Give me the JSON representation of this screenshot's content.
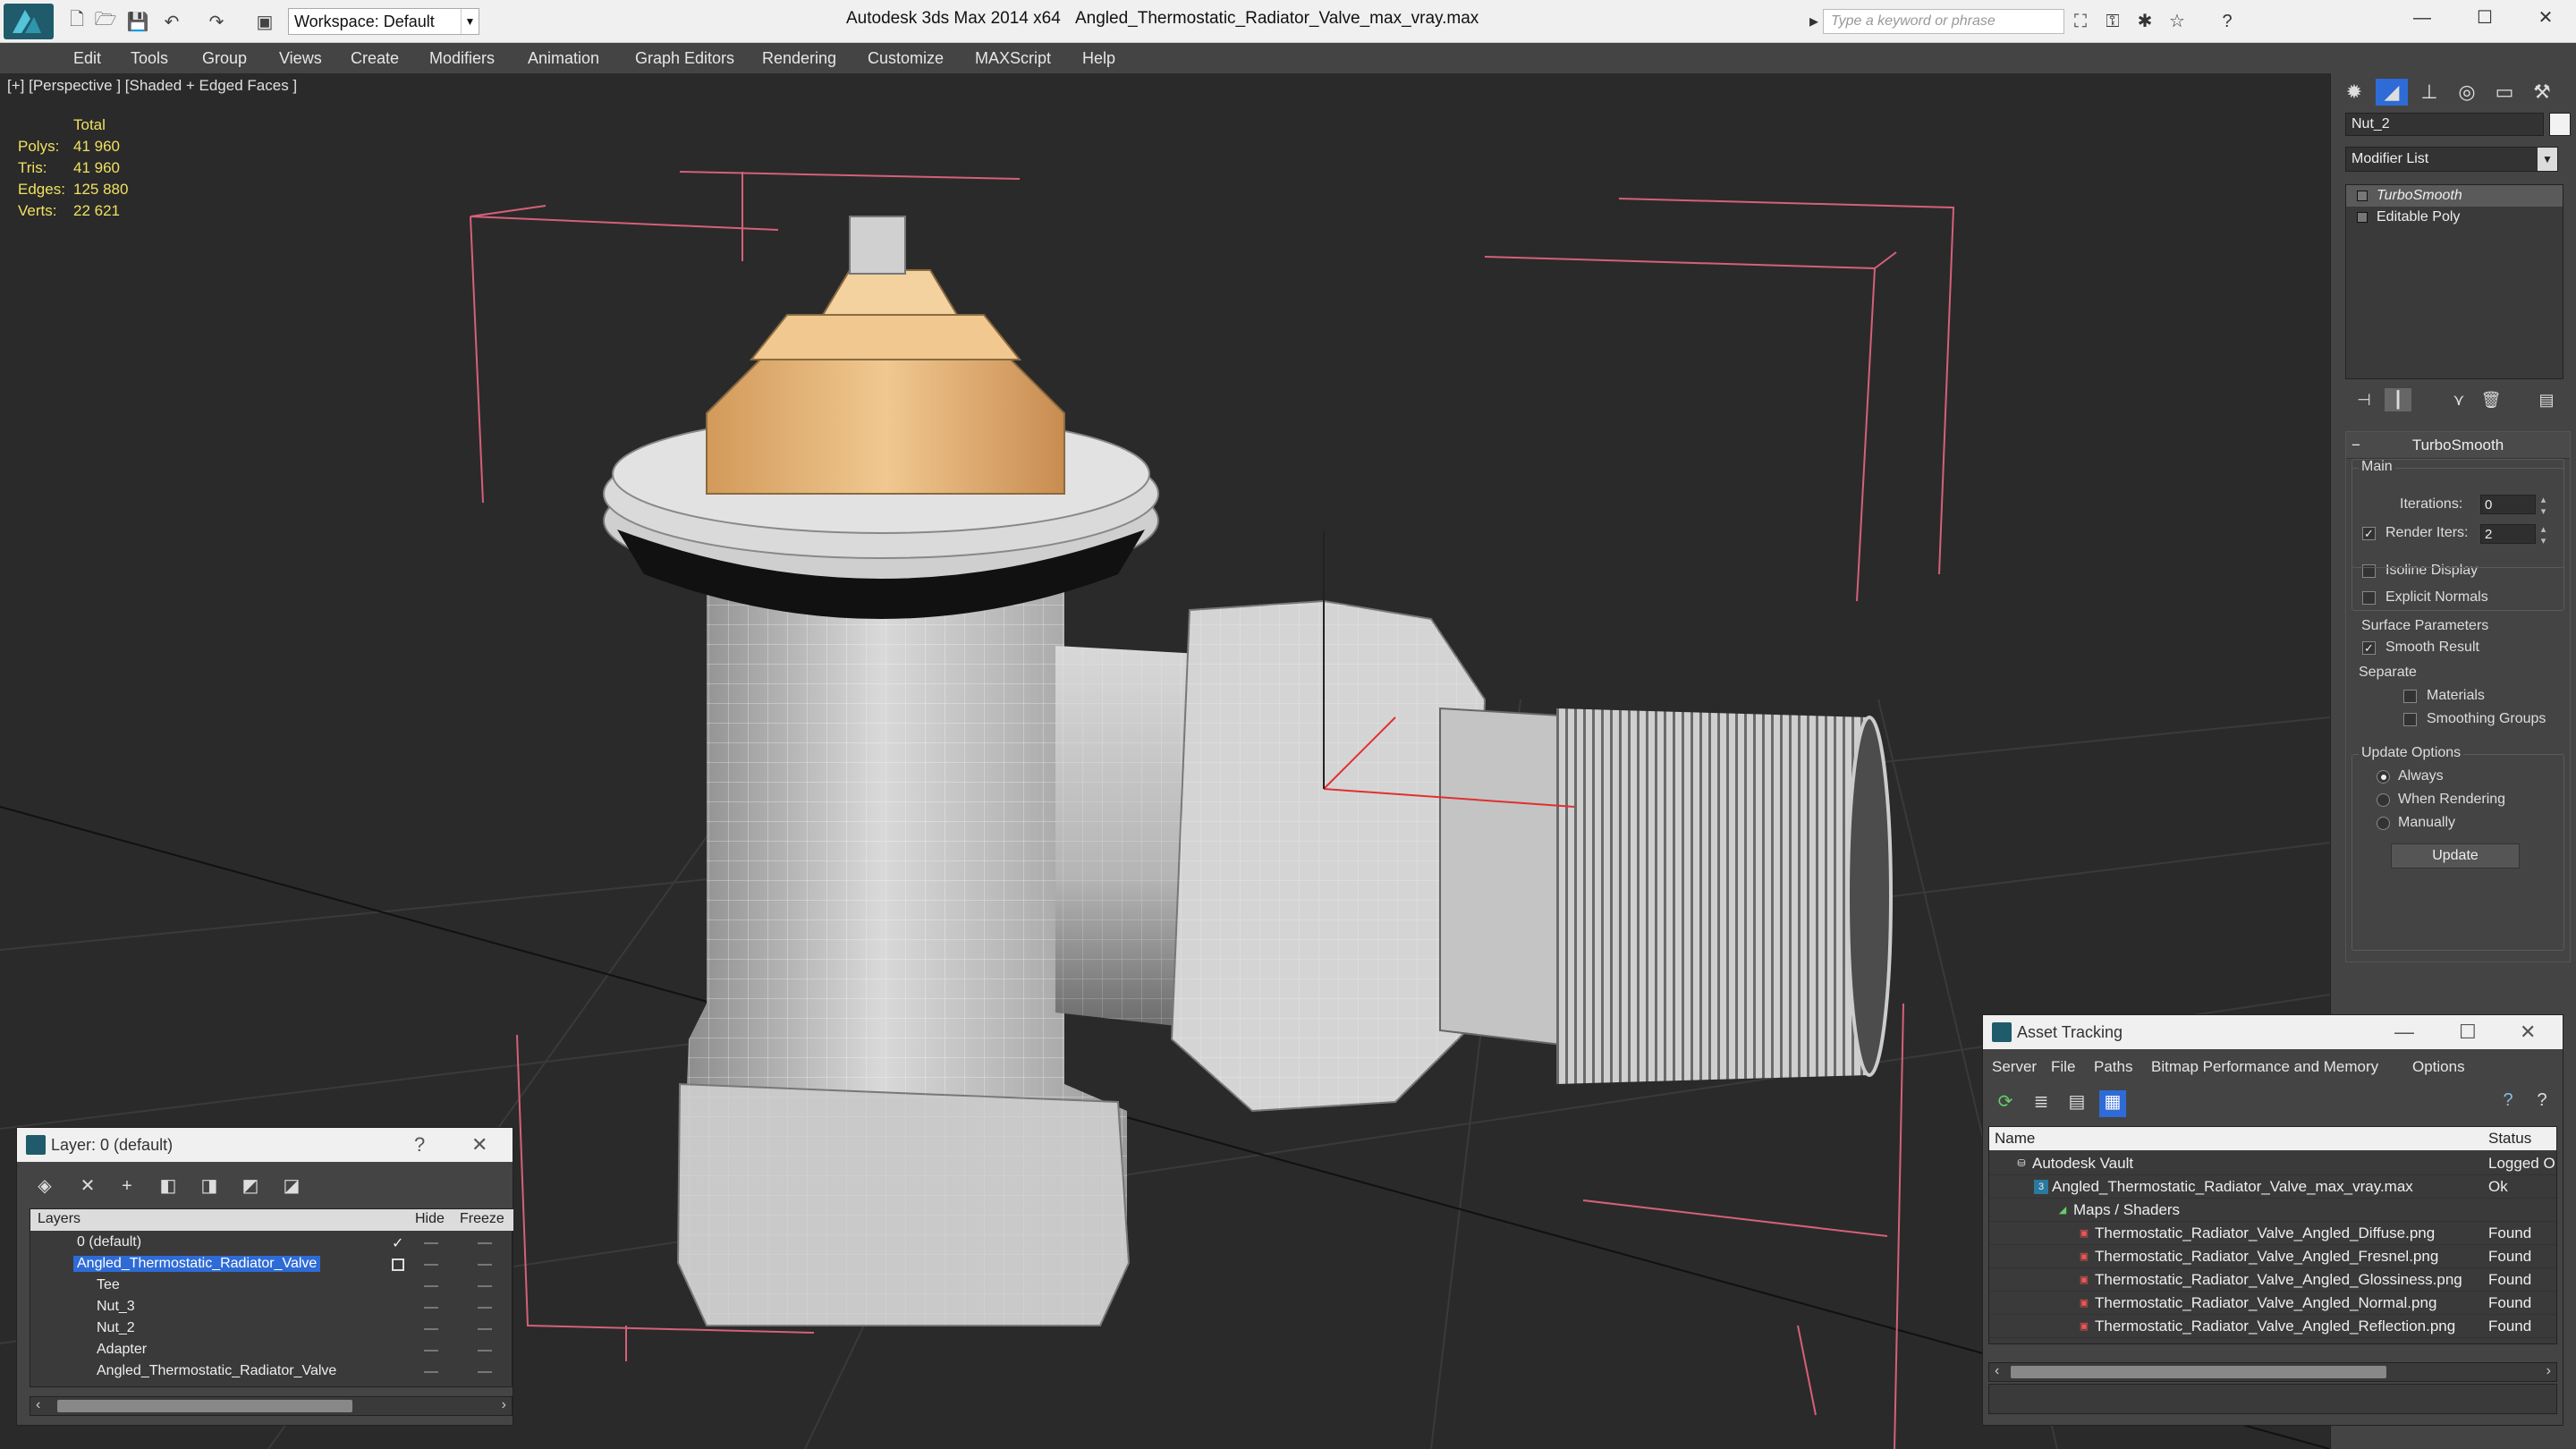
{
  "app": {
    "title": "Autodesk 3ds Max  2014 x64",
    "file": "Angled_Thermostatic_Radiator_Valve_max_vray.max",
    "workspace": "Workspace: Default",
    "search_placeholder": "Type a keyword or phrase"
  },
  "menu": [
    "Edit",
    "Tools",
    "Group",
    "Views",
    "Create",
    "Modifiers",
    "Animation",
    "Graph Editors",
    "Rendering",
    "Customize",
    "MAXScript",
    "Help"
  ],
  "viewport": {
    "label": "[+] [Perspective ] [Shaded + Edged Faces ]",
    "stats": {
      "header": "Total",
      "rows": [
        {
          "label": "Polys:",
          "value": "41 960"
        },
        {
          "label": "Tris:",
          "value": "41 960"
        },
        {
          "label": "Edges:",
          "value": "125 880"
        },
        {
          "label": "Verts:",
          "value": "22 621"
        }
      ]
    }
  },
  "command_panel": {
    "object_name": "Nut_2",
    "modifier_list": "Modifier List",
    "stack": [
      "TurboSmooth",
      "Editable Poly"
    ],
    "rollout_title": "TurboSmooth",
    "main_label": "Main",
    "iterations_label": "Iterations:",
    "iterations_value": "0",
    "render_iters_label": "Render Iters:",
    "render_iters_value": "2",
    "isoline": "Isoline Display",
    "explicit_normals": "Explicit Normals",
    "surface_params": "Surface Parameters",
    "smooth_result": "Smooth Result",
    "separate": "Separate",
    "materials": "Materials",
    "smoothing_groups": "Smoothing Groups",
    "update_options": "Update Options",
    "always": "Always",
    "when_rendering": "When Rendering",
    "manually": "Manually",
    "update_button": "Update"
  },
  "layer_panel": {
    "title": "Layer: 0 (default)",
    "help": "?",
    "columns": [
      "Layers",
      "Hide",
      "Freeze"
    ],
    "rows": [
      {
        "name": "0 (default)",
        "indent": 0
      },
      {
        "name": "Angled_Thermostatic_Radiator_Valve",
        "indent": 0,
        "selected": true
      },
      {
        "name": "Tee",
        "indent": 1
      },
      {
        "name": "Nut_3",
        "indent": 1
      },
      {
        "name": "Nut_2",
        "indent": 1
      },
      {
        "name": "Adapter",
        "indent": 1
      },
      {
        "name": "Angled_Thermostatic_Radiator_Valve",
        "indent": 1
      }
    ]
  },
  "asset_panel": {
    "title": "Asset Tracking",
    "menu": [
      "Server",
      "File",
      "Paths",
      "Bitmap Performance and Memory",
      "Options"
    ],
    "columns": [
      "Name",
      "Status"
    ],
    "rows": [
      {
        "name": "Autodesk Vault",
        "status": "Logged O",
        "indent": 0
      },
      {
        "name": "Angled_Thermostatic_Radiator_Valve_max_vray.max",
        "status": "Ok",
        "indent": 1
      },
      {
        "name": "Maps / Shaders",
        "status": "",
        "indent": 2
      },
      {
        "name": "Thermostatic_Radiator_Valve_Angled_Diffuse.png",
        "status": "Found",
        "indent": 3
      },
      {
        "name": "Thermostatic_Radiator_Valve_Angled_Fresnel.png",
        "status": "Found",
        "indent": 3
      },
      {
        "name": "Thermostatic_Radiator_Valve_Angled_Glossiness.png",
        "status": "Found",
        "indent": 3
      },
      {
        "name": "Thermostatic_Radiator_Valve_Angled_Normal.png",
        "status": "Found",
        "indent": 3
      },
      {
        "name": "Thermostatic_Radiator_Valve_Angled_Reflection.png",
        "status": "Found",
        "indent": 3
      }
    ]
  }
}
